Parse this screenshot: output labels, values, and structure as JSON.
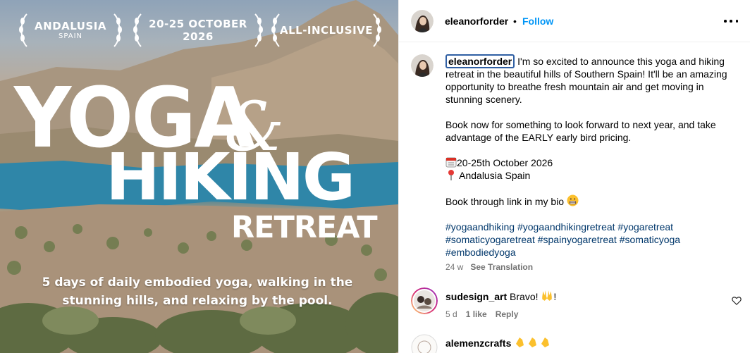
{
  "post_image": {
    "laurels": [
      {
        "main": "ANDALUSIA",
        "sub": "SPAIN"
      },
      {
        "main": "20-25 OCTOBER",
        "sub": "2026"
      },
      {
        "main": "ALL-INCLUSIVE",
        "sub": ""
      }
    ],
    "title_line1": "YOGA",
    "title_amp": "&",
    "title_line2": "HIKING",
    "title_line3": "RETREAT",
    "tagline_line1": "5 days of daily embodied yoga, walking in the",
    "tagline_line2": "stunning hills, and relaxing by the pool."
  },
  "header": {
    "username": "eleanorforder",
    "separator": "•",
    "follow_label": "Follow",
    "more_icon": "more-horizontal-icon"
  },
  "caption": {
    "username": "eleanorforder",
    "text_p1": " I'm so excited to announce this yoga and hiking retreat in the beautiful hills of Southern Spain! It'll be an amazing opportunity to breathe fresh mountain air and get moving in stunning scenery.",
    "text_p2": "Book now for something to look forward to next year, and take advantage of the EARLY early bird pricing.",
    "date_icon": "calendar-emoji",
    "date_line": "20-25th October 2026",
    "location_icon": "pin-emoji",
    "location_line": "Andalusia Spain",
    "text_p4": "Book through link in my bio ",
    "text_p4_icon": "grimacing-face-emoji",
    "hashtags": [
      "#yogaandhiking",
      "#yogaandhikingretreat",
      "#yogaretreat",
      "#somaticyogaretreat",
      "#spainyogaretreat",
      "#somaticyoga",
      "#embodiedyoga"
    ],
    "time_ago": "24 w",
    "see_translation": "See Translation"
  },
  "comments": [
    {
      "username": "sudesign_art",
      "text_before": " Bravo! ",
      "icon": "raising-hands-emoji",
      "text_after": "!",
      "time_ago": "5 d",
      "likes": "1 like",
      "reply": "Reply"
    },
    {
      "username": "alemenzcrafts",
      "text_before": " ",
      "icon": "clapping-hands-emoji",
      "text_after": ""
    }
  ],
  "colors": {
    "link_blue": "#0095f6",
    "hashtag_blue": "#00376b",
    "muted": "#737373"
  }
}
